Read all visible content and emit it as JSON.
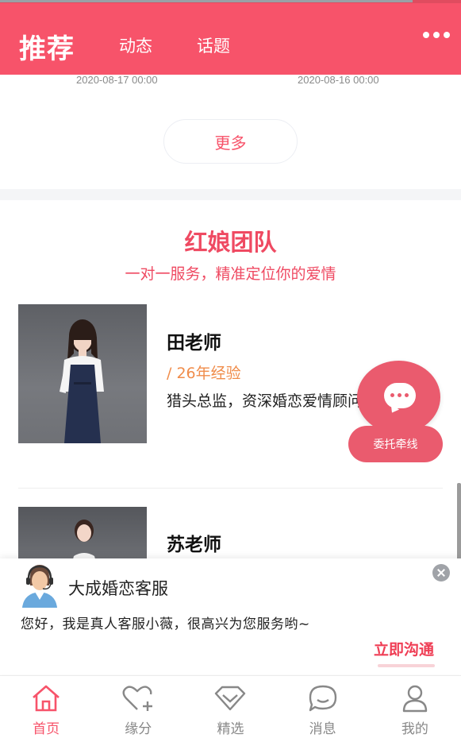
{
  "header": {
    "tab_active": "推荐",
    "tab_2": "动态",
    "tab_3": "话题"
  },
  "posts": {
    "date_1": "2020-08-17 00:00",
    "date_2": "2020-08-16 00:00",
    "more_label": "更多"
  },
  "team": {
    "title": "红娘团队",
    "subtitle": "一对一服务，精准定位你的爱情",
    "members": [
      {
        "name": "田老师",
        "experience": "/ 26年经验",
        "description": "猎头总监，资深婚恋爱情顾问"
      },
      {
        "name": "苏老师"
      }
    ]
  },
  "floating": {
    "entrust_label": "委托牵线"
  },
  "customer_service": {
    "title": "大成婚恋客服",
    "message": "您好，我是真人客服小薇，很高兴为您服务哟~",
    "action_label": "立即沟通"
  },
  "bottom_nav": {
    "items": [
      {
        "label": "首页",
        "icon": "home-icon",
        "active": true
      },
      {
        "label": "缘分",
        "icon": "heart-plus-icon"
      },
      {
        "label": "精选",
        "icon": "diamond-icon"
      },
      {
        "label": "消息",
        "icon": "chat-icon"
      },
      {
        "label": "我的",
        "icon": "user-icon"
      }
    ]
  },
  "colors": {
    "brand": "#f7536a",
    "accent_orange": "#f08c4a",
    "floating_button": "#ea5b6e"
  }
}
